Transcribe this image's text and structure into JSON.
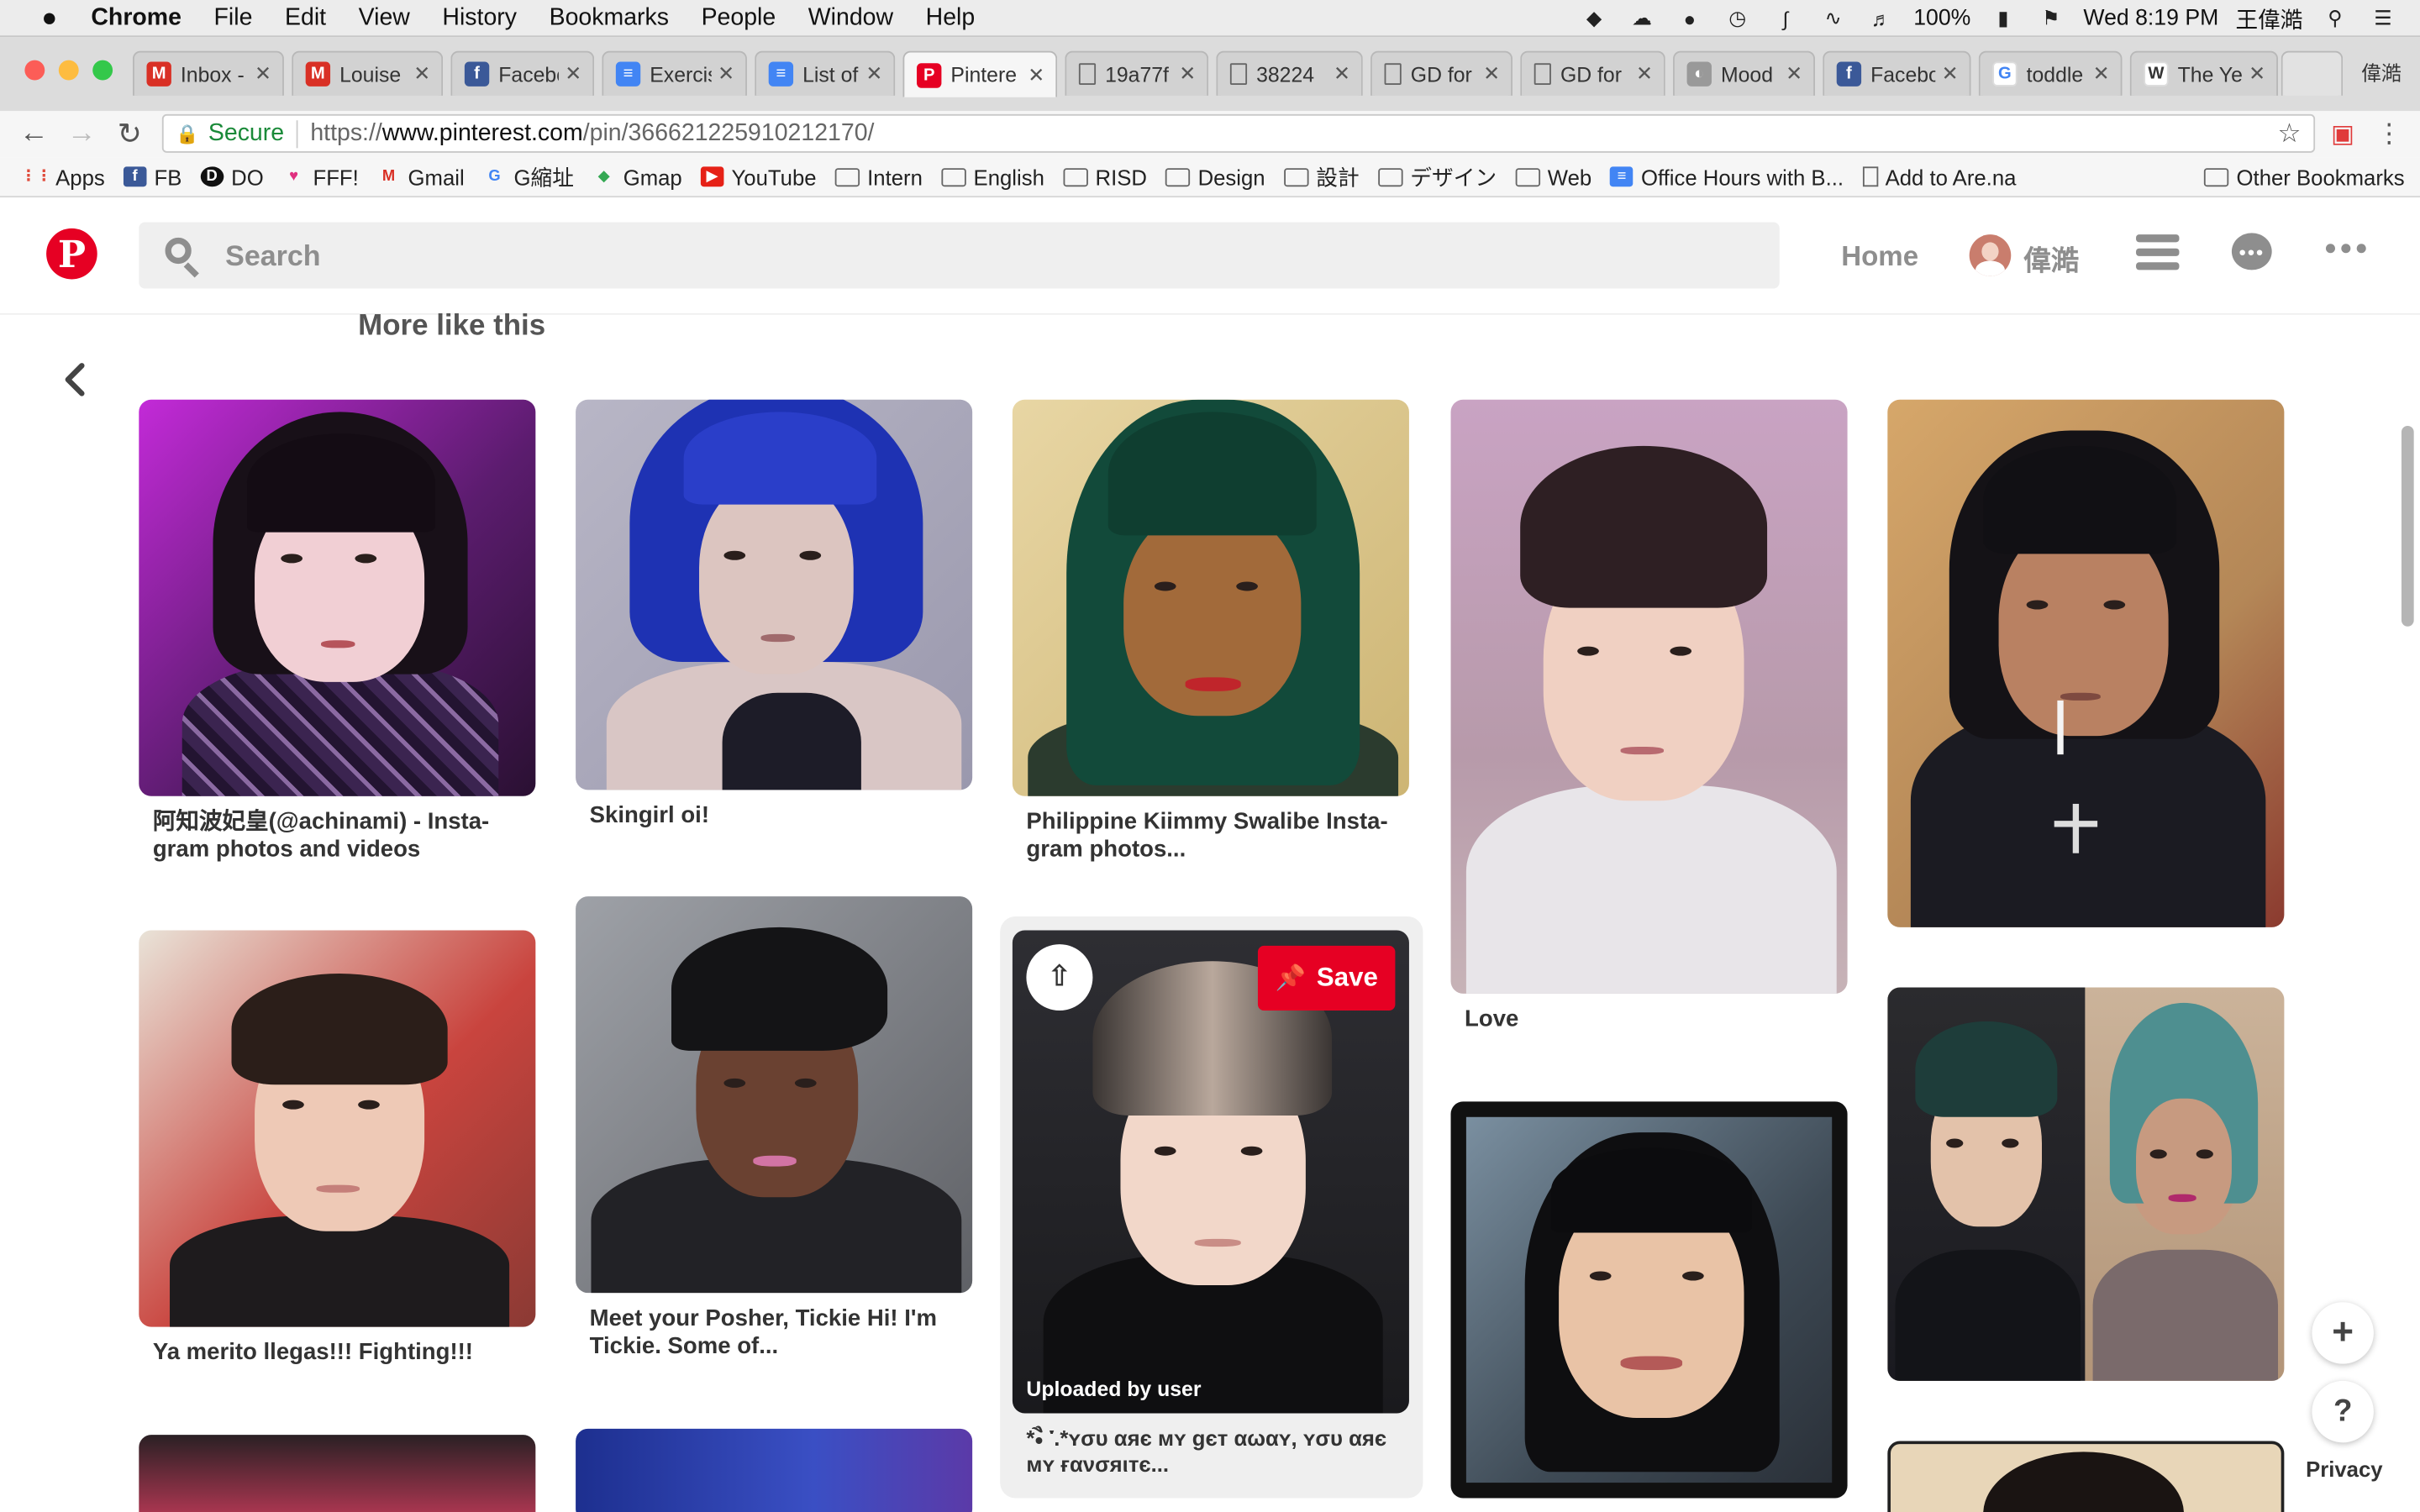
{
  "menubar": {
    "apple": "",
    "app_name": "Chrome",
    "items": [
      "File",
      "Edit",
      "View",
      "History",
      "Bookmarks",
      "People",
      "Window",
      "Help"
    ],
    "battery": "100%",
    "clock": "Wed 8:19 PM",
    "user": "王偉澔"
  },
  "tabs": [
    {
      "label": "Inbox -",
      "icon": "gmail-icon",
      "color": "#d93025"
    },
    {
      "label": "Louise",
      "icon": "gmail-icon",
      "color": "#d93025"
    },
    {
      "label": "Facebo",
      "icon": "facebook-icon",
      "color": "#3b5998"
    },
    {
      "label": "Exercis",
      "icon": "docs-icon",
      "color": "#4285f4"
    },
    {
      "label": "List of",
      "icon": "docs-icon",
      "color": "#4285f4"
    },
    {
      "label": "Pintere",
      "icon": "pinterest-icon",
      "color": "#e60023"
    },
    {
      "label": "19a77f",
      "icon": "page-icon",
      "color": "#888888"
    },
    {
      "label": "38224",
      "icon": "page-icon",
      "color": "#888888"
    },
    {
      "label": "GD for",
      "icon": "page-icon",
      "color": "#888888"
    },
    {
      "label": "GD for",
      "icon": "page-icon",
      "color": "#888888"
    },
    {
      "label": "Mood",
      "icon": "mood-icon",
      "color": "#999999"
    },
    {
      "label": "Facebo",
      "icon": "facebook-icon",
      "color": "#3b5998"
    },
    {
      "label": "toddle",
      "icon": "google-icon",
      "color": "#4285f4"
    },
    {
      "label": "The Ye",
      "icon": "wikipedia-icon",
      "color": "#333333"
    }
  ],
  "profile_name": "偉澔",
  "omnibox": {
    "secure_label": "Secure",
    "url_scheme": "https://",
    "url_host": "www.pinterest.com",
    "url_path": "/pin/366621225910212170/"
  },
  "bookmarks": [
    {
      "label": "Apps",
      "icon": "apps-icon"
    },
    {
      "label": "FB",
      "icon": "facebook-icon"
    },
    {
      "label": "DO",
      "icon": "do-icon"
    },
    {
      "label": "FFF!",
      "icon": "heart-icon"
    },
    {
      "label": "Gmail",
      "icon": "gmail-icon"
    },
    {
      "label": "G縮址",
      "icon": "google-icon"
    },
    {
      "label": "Gmap",
      "icon": "maps-icon"
    },
    {
      "label": "YouTube",
      "icon": "youtube-icon"
    },
    {
      "label": "Intern",
      "icon": "folder-icon"
    },
    {
      "label": "English",
      "icon": "folder-icon"
    },
    {
      "label": "RISD",
      "icon": "folder-icon"
    },
    {
      "label": "Design",
      "icon": "folder-icon"
    },
    {
      "label": "設計",
      "icon": "folder-icon"
    },
    {
      "label": "デザイン",
      "icon": "folder-icon"
    },
    {
      "label": "Web",
      "icon": "folder-icon"
    },
    {
      "label": "Office Hours with B...",
      "icon": "docs-icon"
    },
    {
      "label": "Add to Are.na",
      "icon": "page-icon"
    }
  ],
  "other_bookmarks": "Other Bookmarks",
  "pinterest": {
    "logo_letter": "P",
    "search_placeholder": "Search",
    "home_label": "Home",
    "username": "偉澔",
    "section_title": "More like this",
    "brand_color": "#e60023"
  },
  "pins": [
    {
      "caption": "阿知波妃皇(@achinami) - Insta-gram photos and videos"
    },
    {
      "caption": "Skingirl oi!"
    },
    {
      "caption": "Philippine Kiimmy Swalibe Insta-gram photos..."
    },
    {
      "caption": "Love"
    },
    {
      "caption": ""
    },
    {
      "caption": "Ya merito llegas!!! Fighting!!!"
    },
    {
      "caption": "Meet your Posher, Tickie Hi! I'm Tickie. Some of..."
    },
    {
      "caption": "*•ૈ ་.*ʏσυ αяє мʏ gєт αωαʏ, ʏσυ αяє мʏ ғανσяιтє..."
    },
    {
      "caption": ""
    },
    {
      "caption": ""
    }
  ],
  "hover_pin": {
    "save_label": "Save",
    "uploaded_label": "Uploaded by user"
  },
  "privacy_label": "Privacy",
  "help_label": "?",
  "add_label": "+"
}
